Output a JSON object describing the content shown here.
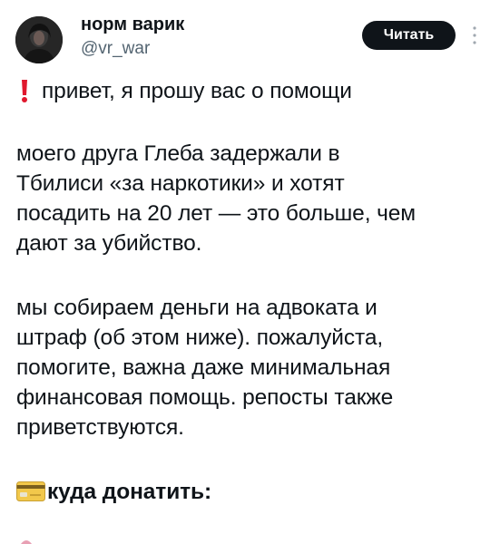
{
  "author": {
    "display_name": "норм варик",
    "handle": "@vr_war"
  },
  "actions": {
    "read_label": "Читать"
  },
  "icons": {
    "more": "more-vertical-icon",
    "exclamation": "red-exclamation-icon",
    "card": "credit-card-emoji-icon"
  },
  "colors": {
    "text": "#0f1419",
    "secondary": "#536471",
    "button_bg": "#0f1419",
    "button_text": "#ffffff",
    "exclamation": "#e0182d"
  },
  "tweet": {
    "p1": "привет, я прошу вас о помощи",
    "p2_l1": "моего друга Глеба задержали в",
    "p2_l2": "Тбилиси «за наркотики» и хотят",
    "p2_l3": "посадить на 20 лет — это больше, чем",
    "p2_l4": "дают за убийство.",
    "p3_l1": "мы собираем деньги на адвоката и",
    "p3_l2": "штраф (об этом ниже). пожалуйста,",
    "p3_l3": "помогите, важна даже минимальная",
    "p3_l4": "финансовая помощь. репосты также",
    "p3_l5": "приветствуются.",
    "donate_heading": "куда донатить:"
  }
}
